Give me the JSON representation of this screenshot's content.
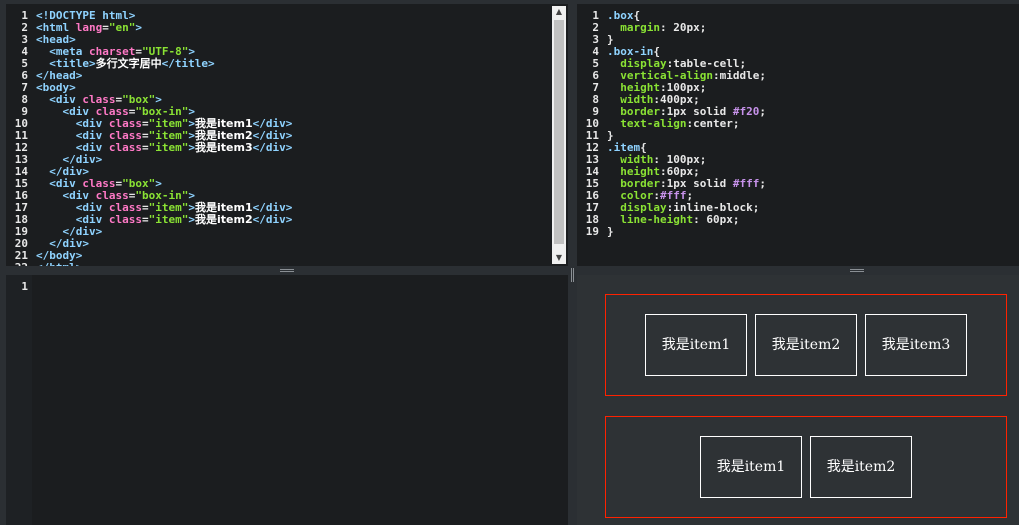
{
  "html_editor": {
    "lines": [
      [
        [
          "tok-doctype",
          "<!DOCTYPE html>"
        ]
      ],
      [
        [
          "tok-tag",
          "<html "
        ],
        [
          "tok-attr",
          "lang"
        ],
        [
          "tok-punc",
          "="
        ],
        [
          "tok-str",
          "\"en\""
        ],
        [
          "tok-tag",
          ">"
        ]
      ],
      [
        [
          "tok-tag",
          "<head>"
        ]
      ],
      [
        [
          "tok-txt",
          "  "
        ],
        [
          "tok-tag",
          "<meta "
        ],
        [
          "tok-attr",
          "charset"
        ],
        [
          "tok-punc",
          "="
        ],
        [
          "tok-str",
          "\"UTF-8\""
        ],
        [
          "tok-tag",
          ">"
        ]
      ],
      [
        [
          "tok-txt",
          "  "
        ],
        [
          "tok-tag",
          "<title>"
        ],
        [
          "tok-text",
          "多行文字居中"
        ],
        [
          "tok-tag",
          "</title>"
        ]
      ],
      [
        [
          "tok-tag",
          "</head>"
        ]
      ],
      [
        [
          "tok-tag",
          "<body>"
        ]
      ],
      [
        [
          "tok-txt",
          "  "
        ],
        [
          "tok-tag",
          "<div "
        ],
        [
          "tok-attr",
          "class"
        ],
        [
          "tok-punc",
          "="
        ],
        [
          "tok-str",
          "\"box\""
        ],
        [
          "tok-tag",
          ">"
        ]
      ],
      [
        [
          "tok-txt",
          "    "
        ],
        [
          "tok-tag",
          "<div "
        ],
        [
          "tok-attr",
          "class"
        ],
        [
          "tok-punc",
          "="
        ],
        [
          "tok-str",
          "\"box-in\""
        ],
        [
          "tok-tag",
          ">"
        ]
      ],
      [
        [
          "tok-txt",
          "      "
        ],
        [
          "tok-tag",
          "<div "
        ],
        [
          "tok-attr",
          "class"
        ],
        [
          "tok-punc",
          "="
        ],
        [
          "tok-str",
          "\"item\""
        ],
        [
          "tok-tag",
          ">"
        ],
        [
          "tok-text",
          "我是item1"
        ],
        [
          "tok-tag",
          "</div>"
        ]
      ],
      [
        [
          "tok-txt",
          "      "
        ],
        [
          "tok-tag",
          "<div "
        ],
        [
          "tok-attr",
          "class"
        ],
        [
          "tok-punc",
          "="
        ],
        [
          "tok-str",
          "\"item\""
        ],
        [
          "tok-tag",
          ">"
        ],
        [
          "tok-text",
          "我是item2"
        ],
        [
          "tok-tag",
          "</div>"
        ]
      ],
      [
        [
          "tok-txt",
          "      "
        ],
        [
          "tok-tag",
          "<div "
        ],
        [
          "tok-attr",
          "class"
        ],
        [
          "tok-punc",
          "="
        ],
        [
          "tok-str",
          "\"item\""
        ],
        [
          "tok-tag",
          ">"
        ],
        [
          "tok-text",
          "我是item3"
        ],
        [
          "tok-tag",
          "</div>"
        ]
      ],
      [
        [
          "tok-txt",
          "    "
        ],
        [
          "tok-tag",
          "</div>"
        ]
      ],
      [
        [
          "tok-txt",
          "  "
        ],
        [
          "tok-tag",
          "</div>"
        ]
      ],
      [
        [
          "tok-txt",
          "  "
        ],
        [
          "tok-tag",
          "<div "
        ],
        [
          "tok-attr",
          "class"
        ],
        [
          "tok-punc",
          "="
        ],
        [
          "tok-str",
          "\"box\""
        ],
        [
          "tok-tag",
          ">"
        ]
      ],
      [
        [
          "tok-txt",
          "    "
        ],
        [
          "tok-tag",
          "<div "
        ],
        [
          "tok-attr",
          "class"
        ],
        [
          "tok-punc",
          "="
        ],
        [
          "tok-str",
          "\"box-in\""
        ],
        [
          "tok-tag",
          ">"
        ]
      ],
      [
        [
          "tok-txt",
          "      "
        ],
        [
          "tok-tag",
          "<div "
        ],
        [
          "tok-attr",
          "class"
        ],
        [
          "tok-punc",
          "="
        ],
        [
          "tok-str",
          "\"item\""
        ],
        [
          "tok-tag",
          ">"
        ],
        [
          "tok-text",
          "我是item1"
        ],
        [
          "tok-tag",
          "</div>"
        ]
      ],
      [
        [
          "tok-txt",
          "      "
        ],
        [
          "tok-tag",
          "<div "
        ],
        [
          "tok-attr",
          "class"
        ],
        [
          "tok-punc",
          "="
        ],
        [
          "tok-str",
          "\"item\""
        ],
        [
          "tok-tag",
          ">"
        ],
        [
          "tok-text",
          "我是item2"
        ],
        [
          "tok-tag",
          "</div>"
        ]
      ],
      [
        [
          "tok-txt",
          "    "
        ],
        [
          "tok-tag",
          "</div>"
        ]
      ],
      [
        [
          "tok-txt",
          "  "
        ],
        [
          "tok-tag",
          "</div>"
        ]
      ],
      [
        [
          "tok-tag",
          "</body>"
        ]
      ],
      [
        [
          "tok-tag",
          "</html>"
        ]
      ]
    ]
  },
  "css_editor": {
    "lines": [
      [
        [
          "tok-sel",
          ".box"
        ],
        [
          "tok-punc",
          "{"
        ]
      ],
      [
        [
          "tok-txt",
          "  "
        ],
        [
          "tok-prop",
          "margin"
        ],
        [
          "tok-punc",
          ": "
        ],
        [
          "tok-num",
          "20px"
        ],
        [
          "tok-punc",
          ";"
        ]
      ],
      [
        [
          "tok-punc",
          "}"
        ]
      ],
      [
        [
          "tok-sel",
          ".box-in"
        ],
        [
          "tok-punc",
          "{"
        ]
      ],
      [
        [
          "tok-txt",
          "  "
        ],
        [
          "tok-prop",
          "display"
        ],
        [
          "tok-punc",
          ":"
        ],
        [
          "tok-val",
          "table-cell"
        ],
        [
          "tok-punc",
          ";"
        ]
      ],
      [
        [
          "tok-txt",
          "  "
        ],
        [
          "tok-prop",
          "vertical-align"
        ],
        [
          "tok-punc",
          ":"
        ],
        [
          "tok-val",
          "middle"
        ],
        [
          "tok-punc",
          ";"
        ]
      ],
      [
        [
          "tok-txt",
          "  "
        ],
        [
          "tok-prop",
          "height"
        ],
        [
          "tok-punc",
          ":"
        ],
        [
          "tok-num",
          "100px"
        ],
        [
          "tok-punc",
          ";"
        ]
      ],
      [
        [
          "tok-txt",
          "  "
        ],
        [
          "tok-prop",
          "width"
        ],
        [
          "tok-punc",
          ":"
        ],
        [
          "tok-num",
          "400px"
        ],
        [
          "tok-punc",
          ";"
        ]
      ],
      [
        [
          "tok-txt",
          "  "
        ],
        [
          "tok-prop",
          "border"
        ],
        [
          "tok-punc",
          ":"
        ],
        [
          "tok-num",
          "1px solid "
        ],
        [
          "tok-color",
          "#f20"
        ],
        [
          "tok-punc",
          ";"
        ]
      ],
      [
        [
          "tok-txt",
          "  "
        ],
        [
          "tok-prop",
          "text-align"
        ],
        [
          "tok-punc",
          ":"
        ],
        [
          "tok-val",
          "center"
        ],
        [
          "tok-punc",
          ";"
        ]
      ],
      [
        [
          "tok-punc",
          "}"
        ]
      ],
      [
        [
          "tok-sel",
          ".item"
        ],
        [
          "tok-punc",
          "{"
        ]
      ],
      [
        [
          "tok-txt",
          "  "
        ],
        [
          "tok-prop",
          "width"
        ],
        [
          "tok-punc",
          ": "
        ],
        [
          "tok-num",
          "100px"
        ],
        [
          "tok-punc",
          ";"
        ]
      ],
      [
        [
          "tok-txt",
          "  "
        ],
        [
          "tok-prop",
          "height"
        ],
        [
          "tok-punc",
          ":"
        ],
        [
          "tok-num",
          "60px"
        ],
        [
          "tok-punc",
          ";"
        ]
      ],
      [
        [
          "tok-txt",
          "  "
        ],
        [
          "tok-prop",
          "border"
        ],
        [
          "tok-punc",
          ":"
        ],
        [
          "tok-num",
          "1px solid "
        ],
        [
          "tok-color",
          "#fff"
        ],
        [
          "tok-punc",
          ";"
        ]
      ],
      [
        [
          "tok-txt",
          "  "
        ],
        [
          "tok-prop",
          "color"
        ],
        [
          "tok-punc",
          ":"
        ],
        [
          "tok-color",
          "#fff"
        ],
        [
          "tok-punc",
          ";"
        ]
      ],
      [
        [
          "tok-txt",
          "  "
        ],
        [
          "tok-prop",
          "display"
        ],
        [
          "tok-punc",
          ":"
        ],
        [
          "tok-val",
          "inline-block"
        ],
        [
          "tok-punc",
          ";"
        ]
      ],
      [
        [
          "tok-txt",
          "  "
        ],
        [
          "tok-prop",
          "line-height"
        ],
        [
          "tok-punc",
          ": "
        ],
        [
          "tok-num",
          "60px"
        ],
        [
          "tok-punc",
          ";"
        ]
      ],
      [
        [
          "tok-punc",
          "}"
        ]
      ]
    ]
  },
  "js_editor": {
    "line_numbers": [
      "1"
    ]
  },
  "result": {
    "boxes": [
      {
        "items": [
          "我是item1",
          "我是item2",
          "我是item3"
        ]
      },
      {
        "items": [
          "我是item1",
          "我是item2"
        ]
      }
    ]
  },
  "scrollbar": {
    "up_glyph": "▲",
    "down_glyph": "▼"
  },
  "colors": {
    "editor_bg": "#1b1d1f",
    "result_bg": "#2e3235",
    "box_border": "#ff2200",
    "item_border": "#ffffff"
  }
}
